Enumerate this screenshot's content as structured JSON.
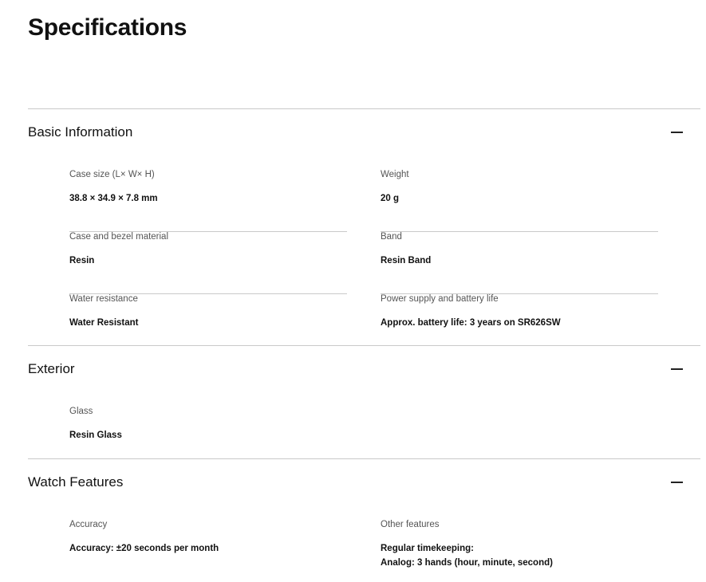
{
  "page": {
    "title": "Specifications"
  },
  "sections": [
    {
      "title": "Basic Information",
      "toggle_icon": "minus-icon",
      "specs": [
        {
          "label": "Case size (L× W× H)",
          "value": "38.8 × 34.9 × 7.8 mm"
        },
        {
          "label": "Weight",
          "value": "20 g"
        },
        {
          "label": "Case and bezel material",
          "value": "Resin"
        },
        {
          "label": "Band",
          "value": "Resin Band"
        },
        {
          "label": "Water resistance",
          "value": "Water Resistant"
        },
        {
          "label": "Power supply and battery life",
          "value": "Approx. battery life: 3 years on SR626SW"
        }
      ]
    },
    {
      "title": "Exterior",
      "toggle_icon": "minus-icon",
      "specs": [
        {
          "label": "Glass",
          "value": "Resin Glass"
        }
      ]
    },
    {
      "title": "Watch Features",
      "toggle_icon": "minus-icon",
      "specs": [
        {
          "label": "Accuracy",
          "value": "Accuracy: ±20 seconds per month"
        },
        {
          "label": "Other features",
          "value": "Regular timekeeping:\nAnalog: 3 hands (hour, minute, second)"
        }
      ]
    }
  ]
}
